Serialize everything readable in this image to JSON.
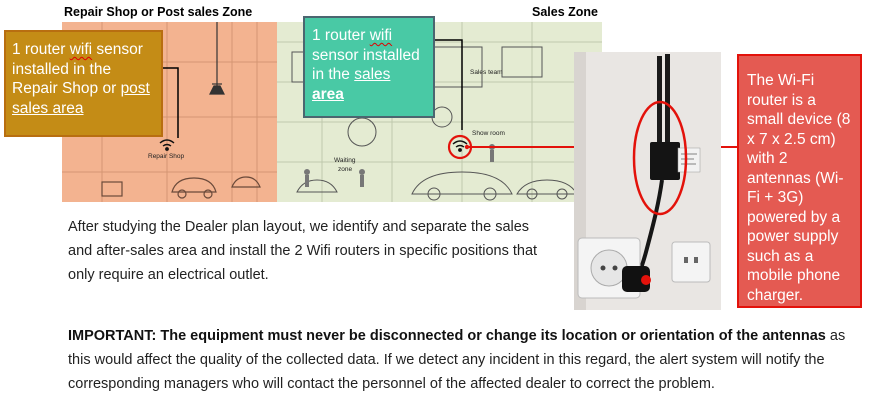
{
  "zones": {
    "repair_title": "Repair Shop or Post sales Zone",
    "sales_title": "Sales Zone"
  },
  "plan_labels": {
    "repair_shop": "Repair Shop",
    "sales_team": "Sales team",
    "show_room": "Show room",
    "waiting_zone_line1": "Waiting",
    "waiting_zone_line2": "zone"
  },
  "callouts": {
    "repair": {
      "t1": "1 router ",
      "t2": "wifi",
      "t3": " sensor installed in the Repair Shop or ",
      "t4": "post sales area"
    },
    "sales": {
      "t1": "1 router ",
      "t2": "wifi",
      "t3": " sensor installed in the ",
      "t4": "sales ",
      "t5": "area"
    },
    "device": "The Wi-Fi router is a small device (8 x 7 x 2.5 cm) with 2 antennas (Wi-Fi + 3G) powered by a power supply such as a mobile phone charger."
  },
  "body_text": "After studying the Dealer plan layout, we identify and separate the sales and after-sales area and install the 2 Wifi routers in specific positions that only require an electrical outlet.",
  "important": {
    "bold": "IMPORTANT: The equipment must never be disconnected or change its location or orientation of the antennas",
    "rest": " as this would affect the quality of the collected data. If we detect any incident in this regard, the alert system will notify the corresponding managers who will contact the personnel of the affected dealer to correct the problem."
  },
  "colors": {
    "repair_zone": "#f3b390",
    "sales_zone": "#e4ebd2",
    "callout_repair": "#c48c16",
    "callout_sales": "#49c9a5",
    "callout_device": "#e45a52",
    "highlight_red": "#e3120b"
  },
  "icons": [
    "wifi-icon-repair",
    "wifi-icon-sales",
    "router-device-photo"
  ]
}
